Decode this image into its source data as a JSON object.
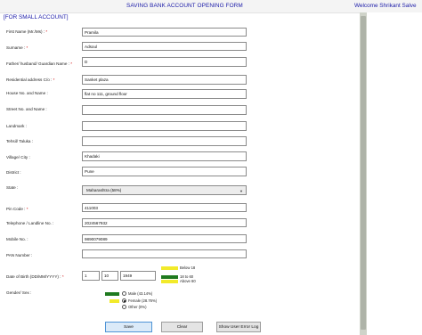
{
  "header": {
    "title": "SAVING BANK ACCOUNT OPENING FORM",
    "welcome": "Welcome Shrikant Salve",
    "subtitle": "[FOR SMALL ACCOUNT]"
  },
  "form": {
    "first_name": {
      "label": "First Name (Mr./Ms) :",
      "required": "*",
      "value": "Pramila"
    },
    "surname": {
      "label": "Surname :",
      "required": "*",
      "value": "Adsoul"
    },
    "father_name": {
      "label": "Father/ husband/ Guardian Name :",
      "required": "*",
      "value": "D"
    },
    "residential_address": {
      "label": "Residential address C/o :",
      "required": "*",
      "value": "Sanket plaza"
    },
    "house_no": {
      "label": "House No. and Name :",
      "value": "flat no 111, ground floor"
    },
    "street": {
      "label": "Street No. and Name :",
      "value": ""
    },
    "landmark": {
      "label": "Landmark :",
      "value": ""
    },
    "tehsil": {
      "label": "Tehsil/ Taluka :",
      "value": ""
    },
    "village_city": {
      "label": "Village/ City :",
      "value": "Khadaki"
    },
    "district": {
      "label": "District :",
      "value": "Pune"
    },
    "state": {
      "label": "State :",
      "value": "Maharashtra (58%)"
    },
    "pin_code": {
      "label": "Pin Code :",
      "required": "*",
      "value": "411003"
    },
    "telephone": {
      "label": "Telephone / Landline No. :",
      "value": "2024567932"
    },
    "mobile": {
      "label": "Mobile No. :",
      "value": "9890079089"
    },
    "pan": {
      "label": "PAN Number :",
      "value": ""
    },
    "dob": {
      "label": "Date of Birth (DD/MM/YYYY) :",
      "required": "*",
      "day": "1",
      "month": "10",
      "year": "1949"
    },
    "age_legend": [
      {
        "label": "Below 18",
        "color": "#f2ea2a"
      },
      {
        "label": "18 to 60",
        "color": "#1f7a1f"
      },
      {
        "label": "Above 60",
        "color": "#f2ea2a"
      }
    ],
    "gender": {
      "label": "Gender/ Sex :",
      "options": [
        {
          "label": "Male (43.14%)",
          "selected": false,
          "color": "#1f7a1f"
        },
        {
          "label": "Female (28.76%)",
          "selected": true,
          "color": "#f2ea2a"
        },
        {
          "label": "Other (0%)",
          "selected": false,
          "color": ""
        }
      ]
    }
  },
  "buttons": {
    "save": "Save",
    "clear": "Clear",
    "show_log": "Show User Error Log"
  },
  "colors": {
    "title_text": "#1a1aa8",
    "required": "#c00000",
    "save_button": "#dbeaf8"
  }
}
